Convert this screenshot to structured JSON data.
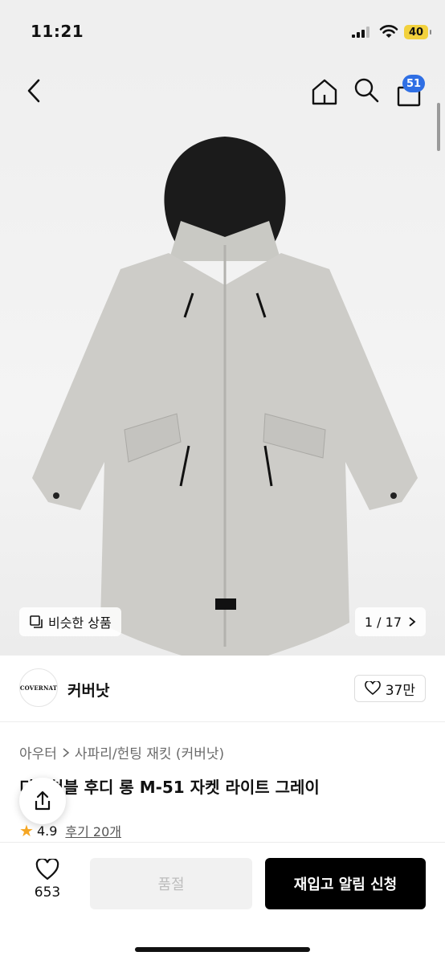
{
  "status": {
    "time": "11:21",
    "battery": "40"
  },
  "header": {
    "cart_count": "51"
  },
  "gallery": {
    "similar_label": "비슷한 상품",
    "pager_text": "1 / 17",
    "brand_tag": "COVERNAT"
  },
  "brand": {
    "logo_text": "COVERNAT",
    "name": "커버낫",
    "likes": "37만"
  },
  "breadcrumb": [
    "아우터",
    "사파리/헌팅 재킷 (커버낫)"
  ],
  "product": {
    "title": "디태쳐블 후디 롱 M-51 자켓 라이트 그레이",
    "rating": "4.9",
    "reviews": "후기 20개"
  },
  "bottom": {
    "wish_count": "653",
    "soldout_label": "품절",
    "notify_label": "재입고 알림 신청"
  },
  "colors": {
    "accent_badge": "#2f6fe4",
    "star": "#f5a623",
    "primary_button": "#000000"
  }
}
